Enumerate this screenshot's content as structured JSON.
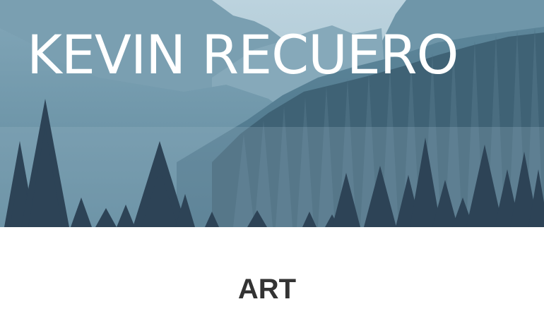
{
  "header": {
    "site_title": "KEVIN RECUERO",
    "hero_image": "misty-mountain-forest"
  },
  "main": {
    "section_heading": "ART"
  },
  "colors": {
    "sky": "#b2ccd8",
    "far_mountains": "#6d96aa",
    "near_mountains": "#557f95",
    "forest": "#2c4257",
    "title_text": "#ffffff",
    "heading_text": "#333333"
  }
}
